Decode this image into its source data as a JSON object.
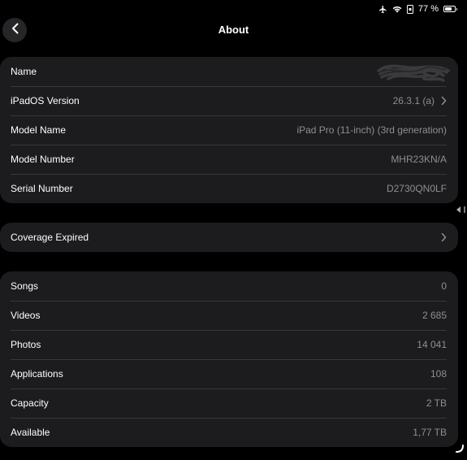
{
  "status_bar": {
    "airplane_icon": "airplane-icon",
    "wifi_icon": "wifi-icon",
    "lock_icon": "orientation-lock-icon",
    "battery_percent": "77 %",
    "battery_level": 0.77
  },
  "nav": {
    "title": "About",
    "back_icon": "chevron-left-icon"
  },
  "device_info": [
    {
      "label": "Name",
      "value": "",
      "redacted": true
    },
    {
      "label": "iPadOS Version",
      "value": "26.3.1 (a)",
      "chevron": true
    },
    {
      "label": "Model Name",
      "value": "iPad Pro (11-inch) (3rd generation)"
    },
    {
      "label": "Model Number",
      "value": "MHR23KN/A"
    },
    {
      "label": "Serial Number",
      "value": "D2730QN0LF"
    }
  ],
  "coverage": {
    "label": "Coverage Expired"
  },
  "stats": [
    {
      "label": "Songs",
      "value": "0"
    },
    {
      "label": "Videos",
      "value": "2 685"
    },
    {
      "label": "Photos",
      "value": "14 041"
    },
    {
      "label": "Applications",
      "value": "108"
    },
    {
      "label": "Capacity",
      "value": "2 TB"
    },
    {
      "label": "Available",
      "value": "1,77 TB"
    }
  ],
  "colors": {
    "background": "#000000",
    "group_background": "#1c1c1e",
    "separator": "#38383a",
    "secondary_text": "#8e8e93"
  }
}
